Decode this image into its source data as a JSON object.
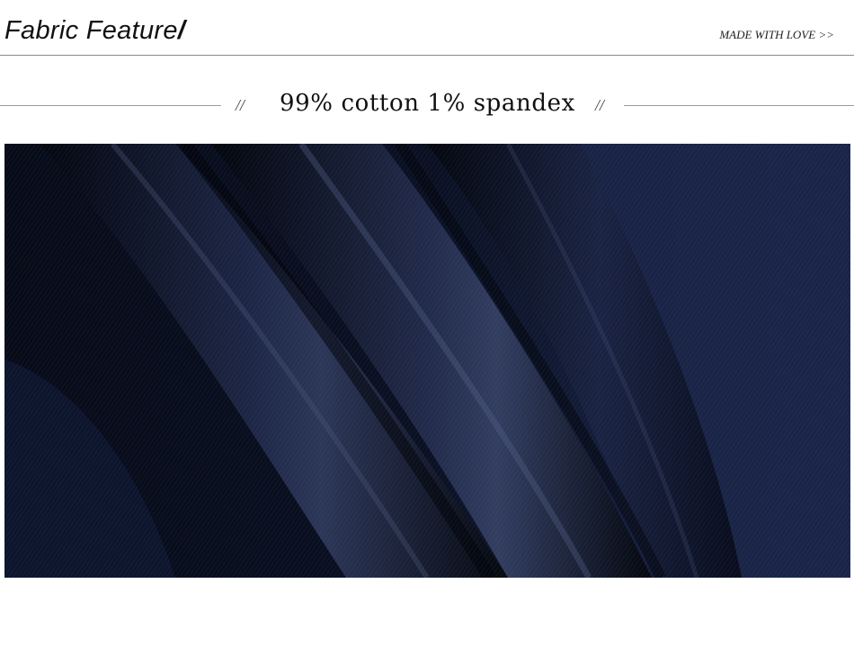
{
  "header": {
    "title": "Fabric Feature",
    "title_suffix": "/",
    "tagline": "MADE WITH LOVE >>"
  },
  "feature": {
    "left_mark": "//",
    "text": "99% cotton 1% spandex",
    "right_mark": "//"
  },
  "photo": {
    "subject": "dark-blue-denim-fabric-folds",
    "colors": {
      "base": "#0c1224",
      "fold_highlight": "#3a4668",
      "shadow": "#03060f"
    }
  }
}
